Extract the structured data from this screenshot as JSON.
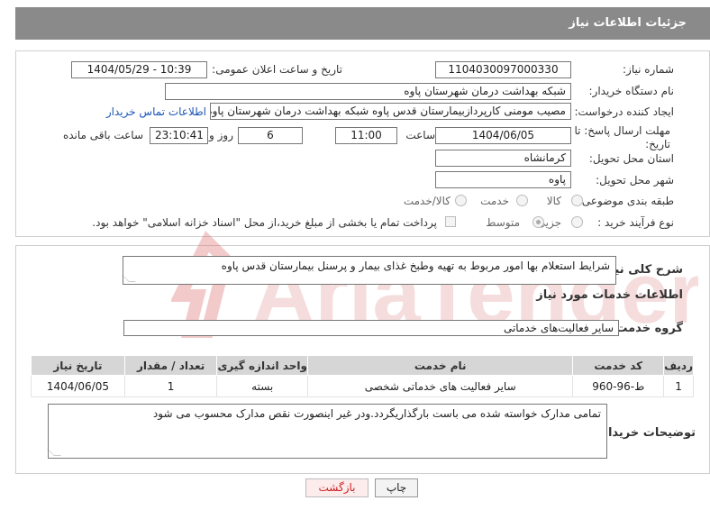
{
  "header": {
    "title": "جزئیات اطلاعات نیاز"
  },
  "form": {
    "need_number_label": "شماره نیاز:",
    "need_number": "1104030097000330",
    "announce_label": "تاریخ و ساعت اعلان عمومی:",
    "announce_value": "1404/05/29 - 10:39",
    "buyer_org_label": "نام دستگاه خریدار:",
    "buyer_org": "شبکه بهداشت درمان شهرستان پاوه",
    "requester_label": "ایجاد کننده درخواست:",
    "requester": "مصیب مومنی کارپردازبیمارستان قدس پاوه شبکه بهداشت درمان شهرستان پاوه",
    "contact_link": "اطلاعات تماس خریدار",
    "deadline_label": "مهلت ارسال پاسخ: تا تاریخ:",
    "deadline_date": "1404/06/05",
    "time_label": "ساعت",
    "deadline_time": "11:00",
    "days_value": "6",
    "days_label": "روز و",
    "remaining_time": "23:10:41",
    "remaining_label": "ساعت باقی مانده",
    "province_label": "استان محل تحویل:",
    "province": "کرمانشاه",
    "city_label": "شهر محل تحویل:",
    "city": "پاوه",
    "category_label": "طبقه بندی موضوعی:",
    "category_options": [
      "کالا",
      "خدمت",
      "کالا/خدمت"
    ],
    "purchase_type_label": "نوع فرآیند خرید :",
    "purchase_options": [
      "جزیی",
      "متوسط"
    ],
    "payment_note": "پرداخت تمام یا بخشی از مبلغ خرید،از محل \"اسناد خزانه اسلامی\" خواهد بود."
  },
  "description": {
    "label": "شرح کلی نیاز:",
    "text": "شرایط استعلام بها امور مربوط به تهیه وطبخ غذای بیمار و پرسنل بیمارستان قدس پاوه"
  },
  "services": {
    "section_title": "اطلاعات خدمات مورد نیاز",
    "group_label": "گروه خدمت:",
    "group_value": "سایر فعالیت‌های خدماتی",
    "columns": [
      "ردیف",
      "کد خدمت",
      "نام خدمت",
      "واحد اندازه گیری",
      "تعداد / مقدار",
      "تاریخ نیاز"
    ],
    "rows": [
      [
        "1",
        "ط-96-960",
        "سایر فعالیت های خدماتی شخصی",
        "بسته",
        "1",
        "1404/06/05"
      ]
    ]
  },
  "buyer_notes": {
    "label": "توضیحات خریدار:",
    "text": "تمامی مدارک خواسته شده می باست بارگذاریگردد.ودر غیر اینصورت نقص مدارک محسوب می شود"
  },
  "buttons": {
    "print": "چاپ",
    "back": "بازگشت"
  },
  "watermark": {
    "text": "AriaTender.net",
    "color": "#e8a0a0"
  }
}
